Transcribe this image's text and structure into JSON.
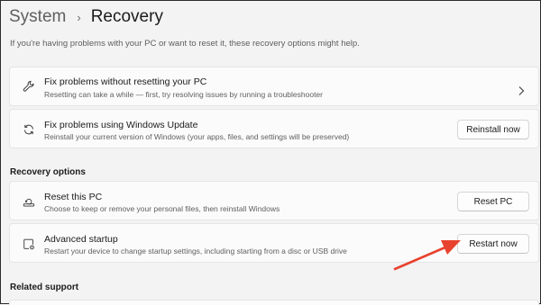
{
  "header": {
    "parent": "System",
    "current": "Recovery",
    "subtitle": "If you're having problems with your PC or want to reset it, these recovery options might help."
  },
  "cards": [
    {
      "title": "Fix problems without resetting your PC",
      "description": "Resetting can take a while — first, try resolving issues by running a troubleshooter",
      "icon": "wrench-icon"
    },
    {
      "title": "Fix problems using Windows Update",
      "description": "Reinstall your current version of Windows (your apps, files, and settings will be preserved)",
      "button": "Reinstall now",
      "icon": "refresh-icon"
    }
  ],
  "recovery_options": {
    "heading": "Recovery options",
    "items": [
      {
        "title": "Reset this PC",
        "description": "Choose to keep or remove your personal files, then reinstall Windows",
        "button": "Reset PC",
        "icon": "reset-pc-icon"
      },
      {
        "title": "Advanced startup",
        "description": "Restart your device to change startup settings, including starting from a disc or USB drive",
        "button": "Restart now",
        "icon": "advanced-startup-icon"
      }
    ]
  },
  "related_support": {
    "heading": "Related support"
  },
  "colors": {
    "annotation_arrow": "#e8432f",
    "background": "#f3f3f3",
    "card": "#fbfbfb"
  }
}
